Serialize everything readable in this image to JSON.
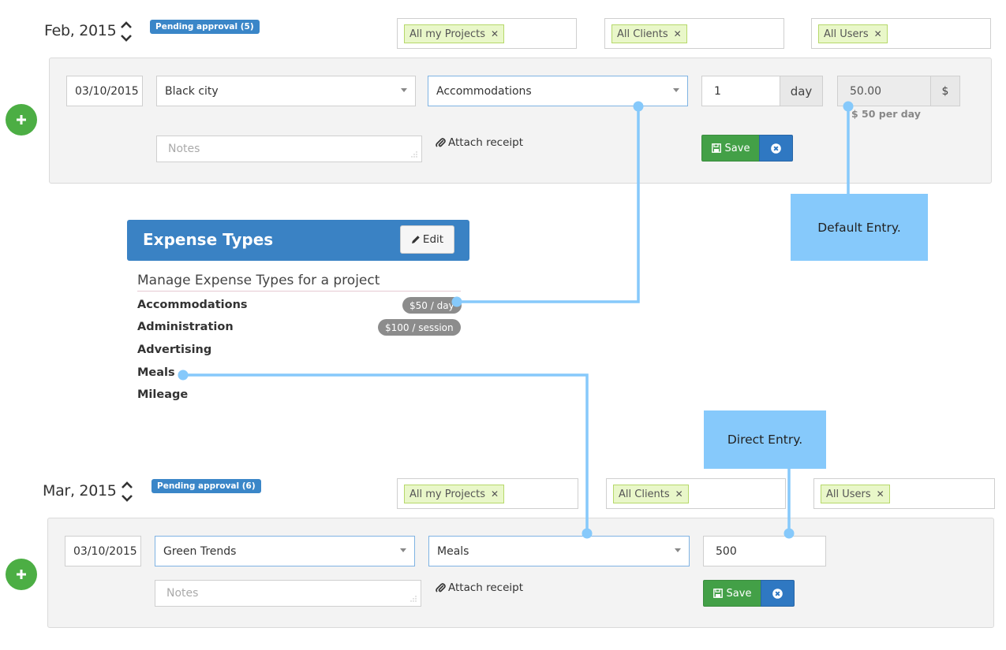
{
  "months": [
    {
      "label": "Feb, 2015",
      "pending": "Pending approval (5)",
      "filters": {
        "projects": "All my Projects",
        "clients": "All Clients",
        "users": "All Users"
      },
      "entry": {
        "date": "03/10/2015",
        "project": "Black city",
        "expense_type": "Accommodations",
        "quantity": "1",
        "unit": "day",
        "amount": "50.00",
        "currency": "$",
        "rate_hint": "$ 50 per day",
        "notes_placeholder": "Notes",
        "attach_label": "Attach receipt",
        "save_label": "Save"
      }
    },
    {
      "label": "Mar, 2015",
      "pending": "Pending approval (6)",
      "filters": {
        "projects": "All my Projects",
        "clients": "All Clients",
        "users": "All Users"
      },
      "entry": {
        "date": "03/10/2015",
        "project": "Green Trends",
        "expense_type": "Meals",
        "amount": "500",
        "notes_placeholder": "Notes",
        "attach_label": "Attach receipt",
        "save_label": "Save"
      }
    }
  ],
  "expense_types": {
    "title": "Expense Types",
    "edit_label": "Edit",
    "subtitle": "Manage Expense Types for a project",
    "items": [
      {
        "name": "Accommodations",
        "rate": "$50 / day"
      },
      {
        "name": "Administration",
        "rate": "$100 / session"
      },
      {
        "name": "Advertising"
      },
      {
        "name": "Meals"
      },
      {
        "name": "Mileage"
      }
    ]
  },
  "callouts": {
    "default_entry": "Default Entry.",
    "direct_entry": "Direct Entry."
  },
  "colors": {
    "callout": "#86c9fb",
    "connector": "#86c9fb",
    "primary": "#3a82c4",
    "success": "#4cae44",
    "tag_bg": "#e9f7c9"
  },
  "icons": {
    "sort": "chevron-up-down-icon",
    "remove": "times-icon",
    "attach": "paperclip-icon",
    "save": "floppy-disk-icon",
    "cancel": "circle-x-icon",
    "edit": "pencil-icon",
    "add": "plus-icon"
  }
}
